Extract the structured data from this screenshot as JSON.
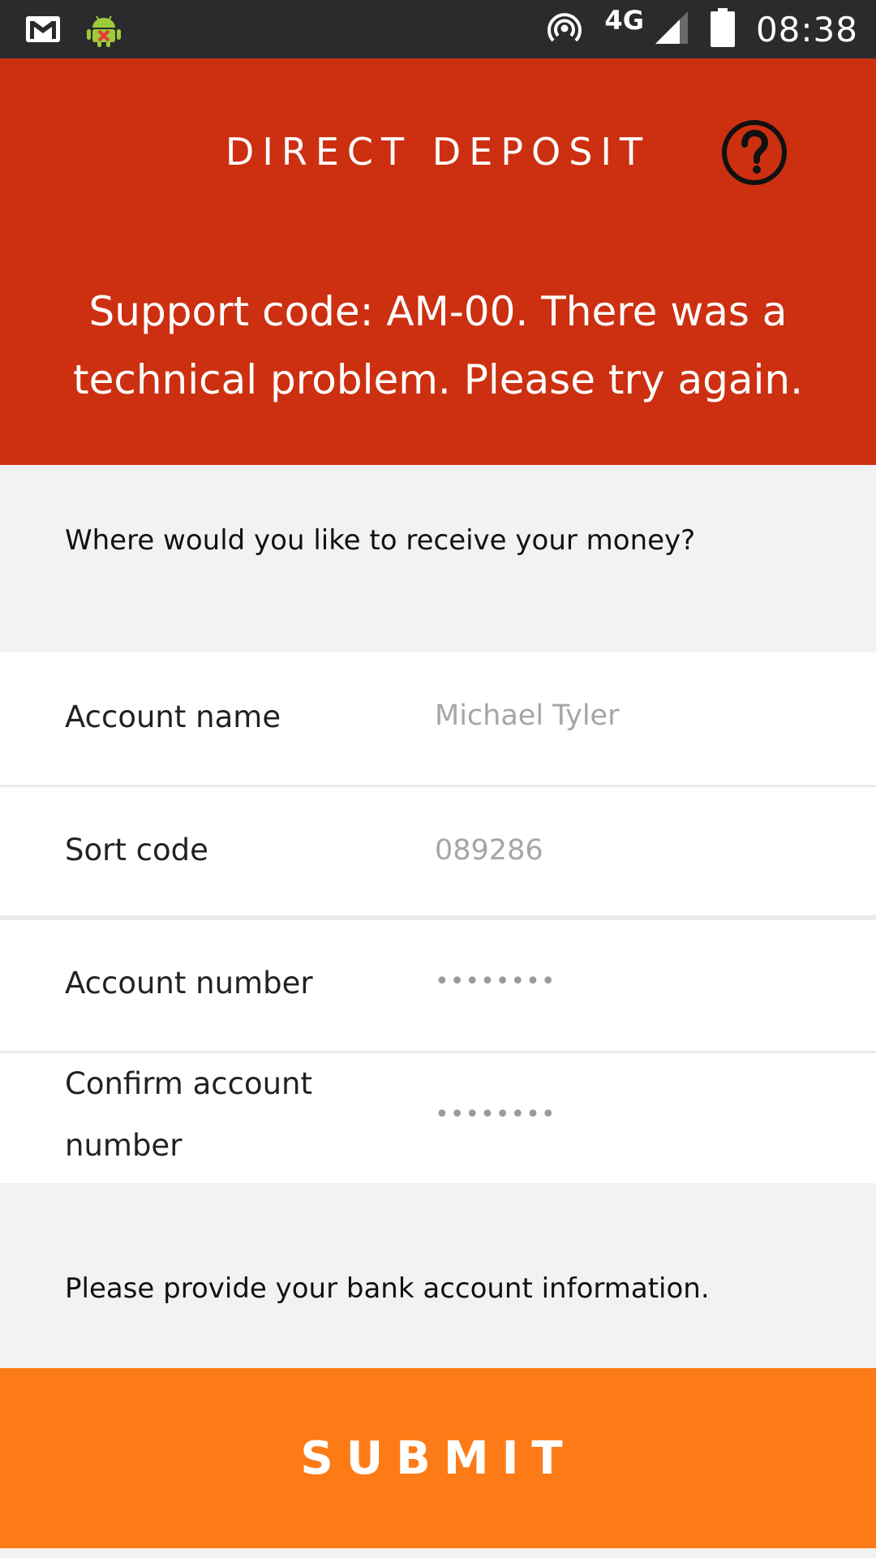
{
  "status_bar": {
    "network_type": "4G",
    "time": "08:38",
    "icons": [
      "gmail-icon",
      "android-debug-icon",
      "hotspot-icon",
      "cell-signal-icon",
      "battery-icon"
    ]
  },
  "header": {
    "title": "DIRECT DEPOSIT",
    "help_icon": "question-circle-icon",
    "error_message": "Support code: AM-00. There was a technical problem. Please try again.",
    "background_color": "#cc3010"
  },
  "question": "Where would you like to receive your money?",
  "form": {
    "fields": [
      {
        "label": "Account name",
        "value": "Michael Tyler"
      },
      {
        "label": "Sort code",
        "value": "089286"
      },
      {
        "label": "Account number",
        "value": "••••••••"
      },
      {
        "label": "Confirm account number",
        "label_line1": "Confirm account",
        "label_line2": "number",
        "value": "••••••••"
      }
    ]
  },
  "hint": "Please provide your bank account information.",
  "submit": {
    "label": "SUBMIT",
    "background_color": "#fd7b17"
  }
}
